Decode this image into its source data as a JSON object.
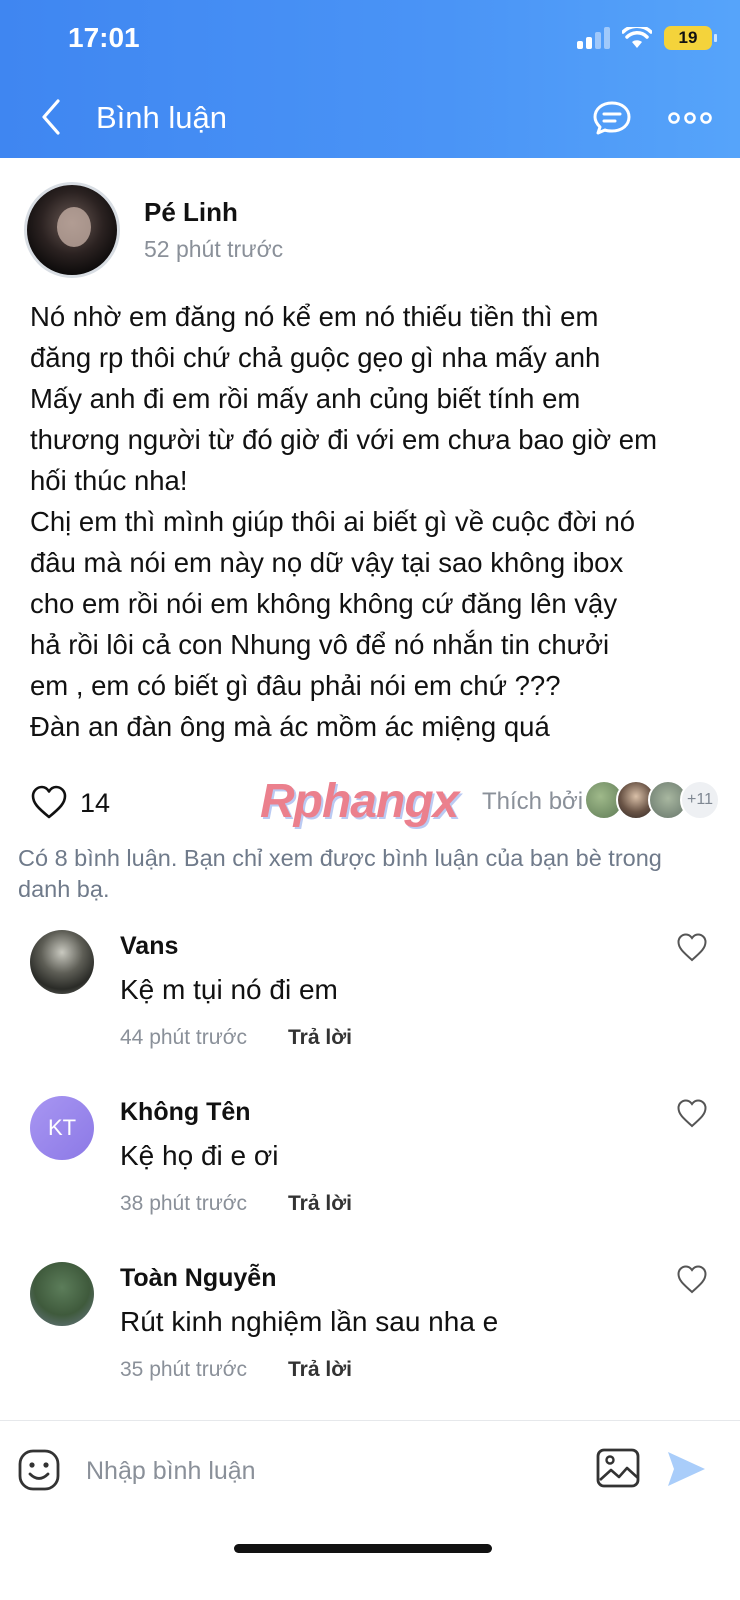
{
  "status_bar": {
    "time": "17:01",
    "battery": "19"
  },
  "header": {
    "title": "Bình luận"
  },
  "post": {
    "author": "Pé Linh",
    "time": "52 phút trước",
    "lines": [
      "Nó nhờ em đăng nó kể em nó thiếu tiền thì em",
      "đăng rp thôi chứ chả guộc gẹo gì nha mấy anh",
      "Mấy anh đi em rồi mấy anh củng biết tính em",
      "thương người từ đó giờ đi với em chưa bao giờ em",
      "hối thúc nha!",
      "Chị em thì mình giúp thôi ai biết gì về cuộc đời nó",
      "đâu mà nói em này nọ dữ vậy tại sao không ibox",
      "cho em rồi nói em không không cứ đăng lên vậy",
      "hả rồi lôi cả con Nhung vô để nó nhắn tin chưởi",
      "em , em có biết gì đâu phải nói em chứ ???",
      "Đàn an đàn ông mà ác mồm ác miệng quá"
    ],
    "like_count": "14",
    "watermark": "Rphangx",
    "liked_by_text": "Thích bởi",
    "more_likers": "+11"
  },
  "comments_note": "Có 8 bình luận. Bạn chỉ xem được bình luận của bạn bè trong danh bạ.",
  "comments": [
    {
      "name": "Vans",
      "text": "Kệ m tụi nó đi em",
      "time": "44 phút trước",
      "reply": "Trả lời"
    },
    {
      "name": "Không Tên",
      "initials": "KT",
      "text": "Kệ họ đi e ơi",
      "time": "38 phút trước",
      "reply": "Trả lời"
    },
    {
      "name": "Toàn Nguyễn",
      "text": "Rút kinh nghiệm lần sau nha e",
      "time": "35 phút trước",
      "reply": "Trả lời"
    }
  ],
  "input": {
    "placeholder": "Nhập bình luận"
  },
  "colors": {
    "header_start": "#3f86f1",
    "header_end": "#56a4fa",
    "send": "#a9cdfa",
    "muted": "#8a9099"
  },
  "icons": [
    "back-icon",
    "chat-icon",
    "more-icon",
    "heart-icon",
    "emoji-icon",
    "image-icon",
    "send-icon"
  ]
}
